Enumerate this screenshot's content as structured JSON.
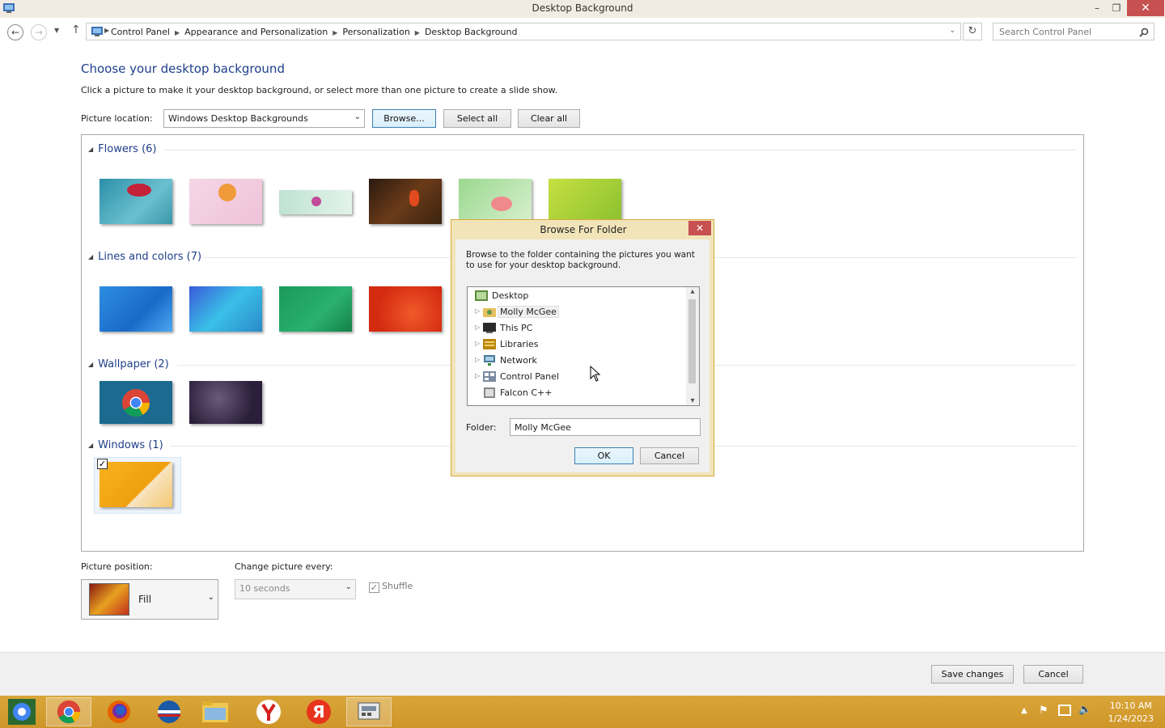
{
  "window": {
    "title": "Desktop Background",
    "minimize": "–",
    "restore": "❐",
    "close": "✕"
  },
  "address": {
    "crumbs": [
      "Control Panel",
      "Appearance and Personalization",
      "Personalization",
      "Desktop Background"
    ],
    "search_placeholder": "Search Control Panel"
  },
  "main": {
    "heading": "Choose your desktop background",
    "subtext": "Click a picture to make it your desktop background, or select more than one picture to create a slide show.",
    "location_label": "Picture location:",
    "location_value": "Windows Desktop Backgrounds",
    "browse_label": "Browse...",
    "select_all_label": "Select all",
    "clear_all_label": "Clear all"
  },
  "groups": [
    {
      "title": "Flowers (6)"
    },
    {
      "title": "Lines and colors (7)"
    },
    {
      "title": "Wallpaper (2)"
    },
    {
      "title": "Windows (1)"
    }
  ],
  "options": {
    "position_label": "Picture position:",
    "position_value": "Fill",
    "interval_label": "Change picture every:",
    "interval_value": "10 seconds",
    "shuffle_label": "Shuffle"
  },
  "footer": {
    "save_label": "Save changes",
    "cancel_label": "Cancel"
  },
  "dialog": {
    "title": "Browse For Folder",
    "instructions": "Browse to the folder containing the pictures you want to use for your desktop background.",
    "tree": [
      "Desktop",
      "Molly McGee",
      "This PC",
      "Libraries",
      "Network",
      "Control Panel",
      "Falcon C++"
    ],
    "folder_label": "Folder:",
    "folder_value": "Molly McGee",
    "ok_label": "OK",
    "cancel_label": "Cancel"
  },
  "taskbar": {
    "time": "10:10 AM",
    "date": "1/24/2023"
  },
  "colors": {
    "heading": "#1e3f8a",
    "taskbar": "#d9a63a",
    "dialog_border": "#d9a83a",
    "close_button": "#c75050"
  }
}
